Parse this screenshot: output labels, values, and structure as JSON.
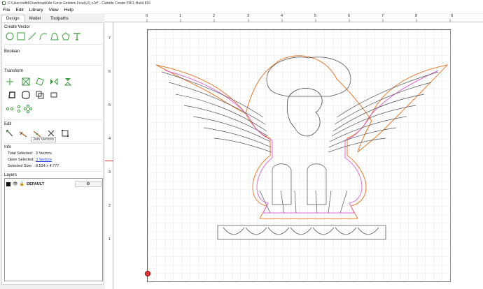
{
  "window": {
    "title": "C:\\Users\\wftd\\Downloads\\Air Force Emblem Final(v2).c2d* - Carbide Create PRO, Build 816"
  },
  "menu": [
    "File",
    "Edit",
    "Library",
    "View",
    "Help"
  ],
  "tabs": [
    "Design",
    "Model",
    "Toolpaths"
  ],
  "sections": {
    "create_vector": "Create Vector",
    "boolean": "Boolean",
    "transform": "Transform",
    "edit": "Edit",
    "info": "Info",
    "layers": "Layers"
  },
  "tooltip": "Join Vectors",
  "info": {
    "total_selected_label": "Total Selected:",
    "total_selected_value": "3 Vectors",
    "open_selected_label": "Open Selected:",
    "open_selected_value": "3 Vectors",
    "selected_size_label": "Selected Size:",
    "selected_size_value": "8.534 x 4.777"
  },
  "layers": [
    {
      "name": "DEFAULT",
      "visible": true,
      "locked": false
    }
  ],
  "ruler": {
    "x_labels": [
      "0",
      "1",
      "2",
      "3",
      "4",
      "5",
      "6",
      "7",
      "8",
      "9"
    ],
    "y_labels": [
      "7",
      "6",
      "5",
      "4",
      "3",
      "2",
      "1"
    ]
  },
  "colors": {
    "accent": "#3a9a3a",
    "orange": "#e87a2a",
    "pink": "#e06bd8",
    "selection": "#1a3cd6"
  }
}
